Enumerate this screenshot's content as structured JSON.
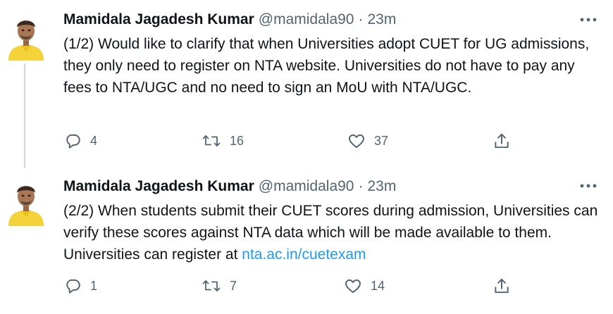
{
  "tweets": [
    {
      "author_name": "Mamidala Jagadesh Kumar",
      "handle": "@mamidala90",
      "separator": "·",
      "time": "23m",
      "text": "(1/2) Would like to clarify that when Universities adopt CUET for UG admissions, they only need to register on NTA website. Universities do not have to pay any fees to NTA/UGC and no need to sign an MoU with NTA/UGC.",
      "replies": "4",
      "retweets": "16",
      "likes": "37"
    },
    {
      "author_name": "Mamidala Jagadesh Kumar",
      "handle": "@mamidala90",
      "separator": "·",
      "time": "23m",
      "text": "(2/2) When students submit their CUET scores during admission, Universities can verify these scores against NTA data which will be made available to them. Universities can register at ",
      "link_text": "nta.ac.in/cuetexam",
      "replies": "1",
      "retweets": "7",
      "likes": "14"
    }
  ],
  "icons": {
    "more": "more-horizontal-icon",
    "reply": "reply-icon",
    "retweet": "retweet-icon",
    "like": "heart-icon",
    "share": "share-icon"
  },
  "colors": {
    "text": "#0f1419",
    "secondary": "#536471",
    "link": "#1d9bf0",
    "thread_line": "#cfd9de"
  }
}
